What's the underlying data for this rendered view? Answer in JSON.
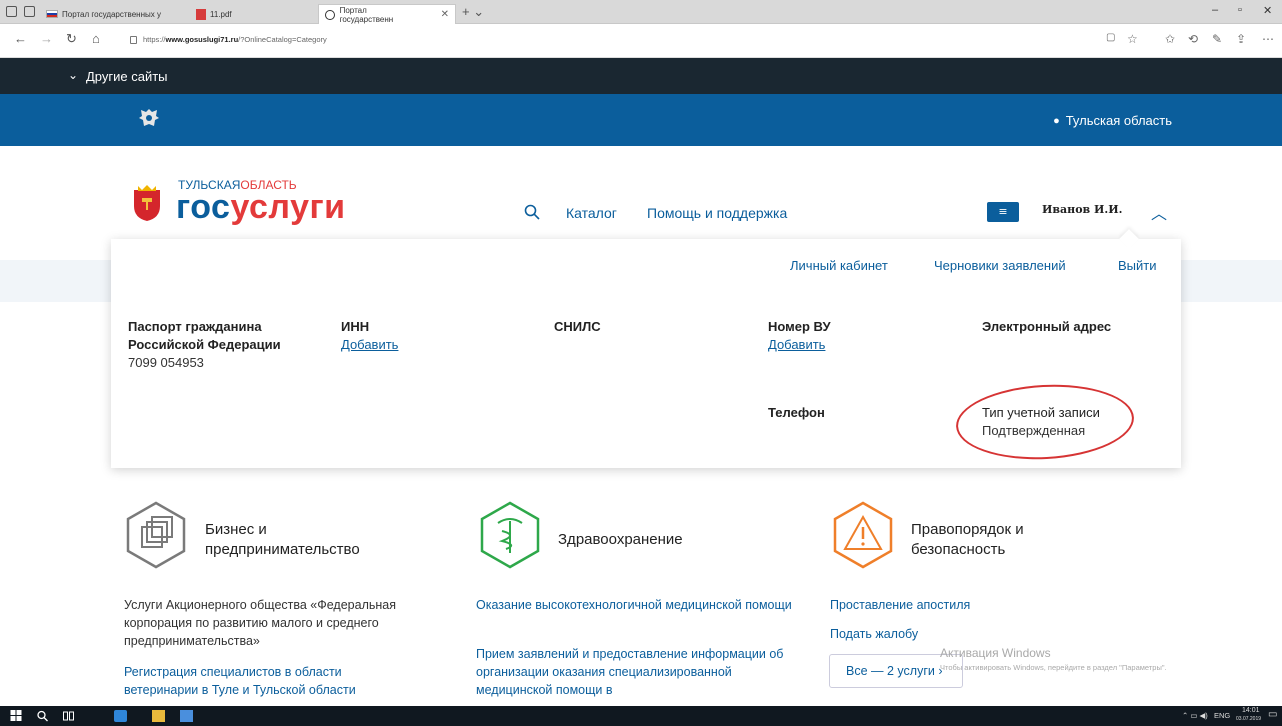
{
  "browser": {
    "tabs": [
      {
        "label": "Портал государственных у",
        "icon": "russia-flag-icon"
      },
      {
        "label": "11.pdf",
        "icon": "pdf-icon"
      },
      {
        "label": "Портал государственн",
        "icon": "loading-icon",
        "active": true
      }
    ],
    "url_prefix": "https://",
    "url_host": "www.gosuslugi71.ru",
    "url_path": "/?OnlineCatalog=Category"
  },
  "topbar": {
    "other_sites": "Другие сайты"
  },
  "region": "Тульская область",
  "header": {
    "logo_sub_a": "ТУЛЬСКАЯ",
    "logo_sub_b": "ОБЛАСТЬ",
    "logo_main_a": "гос",
    "logo_main_b": "услуги",
    "nav": [
      "Каталог",
      "Помощь и поддержка"
    ],
    "user_name": "Иванов И.И."
  },
  "panel": {
    "links": [
      "Личный кабинет",
      "Черновики заявлений",
      "Выйти"
    ],
    "passport": {
      "label": "Паспорт гражданина Российской Федерации",
      "value": "7099 054953"
    },
    "inn": {
      "label": "ИНН",
      "action": "Добавить"
    },
    "snils": {
      "label": "СНИЛС"
    },
    "license": {
      "label": "Номер ВУ",
      "action": "Добавить"
    },
    "email": {
      "label": "Электронный адрес"
    },
    "phone": {
      "label": "Телефон"
    },
    "account_type": {
      "label": "Тип учетной записи",
      "value": "Подтвержденная"
    }
  },
  "categories": [
    {
      "title": "Бизнес и предпринимательство",
      "icon": "business-icon",
      "color": "#7a7a7a",
      "text": "Услуги Акционерного общества «Федеральная корпорация по развитию малого и среднего предпринимательства»",
      "link": "Регистрация специалистов в области ветеринарии в Туле и Тульской области"
    },
    {
      "title": "Здравоохранение",
      "icon": "health-icon",
      "color": "#2ea84a",
      "link1": "Оказание высокотехнологичной медицинской помощи",
      "link2": "Прием заявлений и предоставление информации об организации оказания специализированной медицинской помощи в"
    },
    {
      "title": "Правопорядок и безопасность",
      "icon": "warning-icon",
      "color": "#ef7f2a",
      "link1": "Проставление апостиля",
      "link2": "Подать жалобу",
      "more": "Все — 2 услуги ›"
    }
  ],
  "watermark": {
    "title": "Активация Windows",
    "text": "Чтобы активировать Windows, перейдите в раздел \"Параметры\"."
  },
  "taskbar": {
    "lang": "ENG",
    "time": "14:01",
    "date": "03.07.2019"
  }
}
